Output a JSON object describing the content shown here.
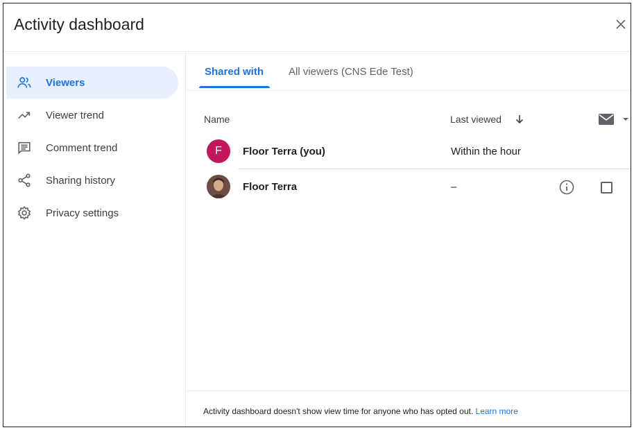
{
  "dialog": {
    "title": "Activity dashboard",
    "close_icon": "close-icon"
  },
  "sidebar": {
    "items": [
      {
        "label": "Viewers",
        "icon": "viewers-icon",
        "active": true
      },
      {
        "label": "Viewer trend",
        "icon": "trend-icon",
        "active": false
      },
      {
        "label": "Comment trend",
        "icon": "comment-icon",
        "active": false
      },
      {
        "label": "Sharing history",
        "icon": "share-icon",
        "active": false
      },
      {
        "label": "Privacy settings",
        "icon": "settings-icon",
        "active": false
      }
    ]
  },
  "tabs": [
    {
      "label": "Shared with",
      "active": true
    },
    {
      "label": "All viewers (CNS Ede Test)",
      "active": false
    }
  ],
  "table": {
    "columns": {
      "name": "Name",
      "last_viewed": "Last viewed"
    },
    "rows": [
      {
        "initial": "F",
        "avatar_color": "#c2185b",
        "name": "Floor Terra (you)",
        "last_viewed": "Within the hour"
      },
      {
        "initial": "",
        "avatar_color": "#8d6e63",
        "name": "Floor Terra",
        "last_viewed": "–"
      }
    ]
  },
  "footer": {
    "text": "Activity dashboard doesn't show view time for anyone who has opted out.",
    "link": "Learn more"
  },
  "colors": {
    "accent": "#1a73e8",
    "active_bg": "#e8f0fe"
  }
}
